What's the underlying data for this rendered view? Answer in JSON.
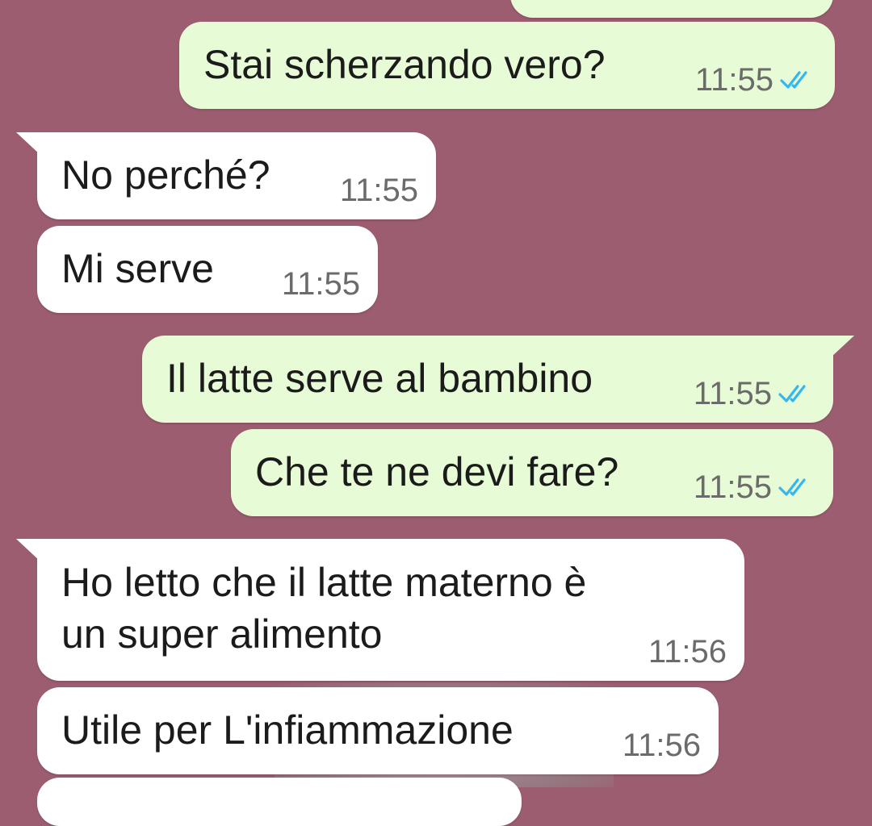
{
  "colors": {
    "chat_background": "#9c5d70",
    "outgoing_bubble": "#e7fbd6",
    "incoming_bubble": "#ffffff",
    "timestamp": "#6b6b6b",
    "read_ticks": "#34b7f1"
  },
  "messages": [
    {
      "direction": "outgoing",
      "text": "Stai scherzando vero?",
      "time": "11:55",
      "status": "read",
      "status_icon": "double-check-icon"
    },
    {
      "direction": "incoming",
      "text": "No perché?",
      "time": "11:55"
    },
    {
      "direction": "incoming",
      "text": "Mi serve",
      "time": "11:55"
    },
    {
      "direction": "outgoing",
      "text": "Il latte serve al bambino",
      "time": "11:55",
      "status": "read",
      "status_icon": "double-check-icon"
    },
    {
      "direction": "outgoing",
      "text": "Che te ne devi fare?",
      "time": "11:55",
      "status": "read",
      "status_icon": "double-check-icon"
    },
    {
      "direction": "incoming",
      "text": "Ho letto che il latte materno è\nun super alimento",
      "time": "11:56"
    },
    {
      "direction": "incoming",
      "text": "Utile per L'infiammazione",
      "time": "11:56"
    }
  ]
}
